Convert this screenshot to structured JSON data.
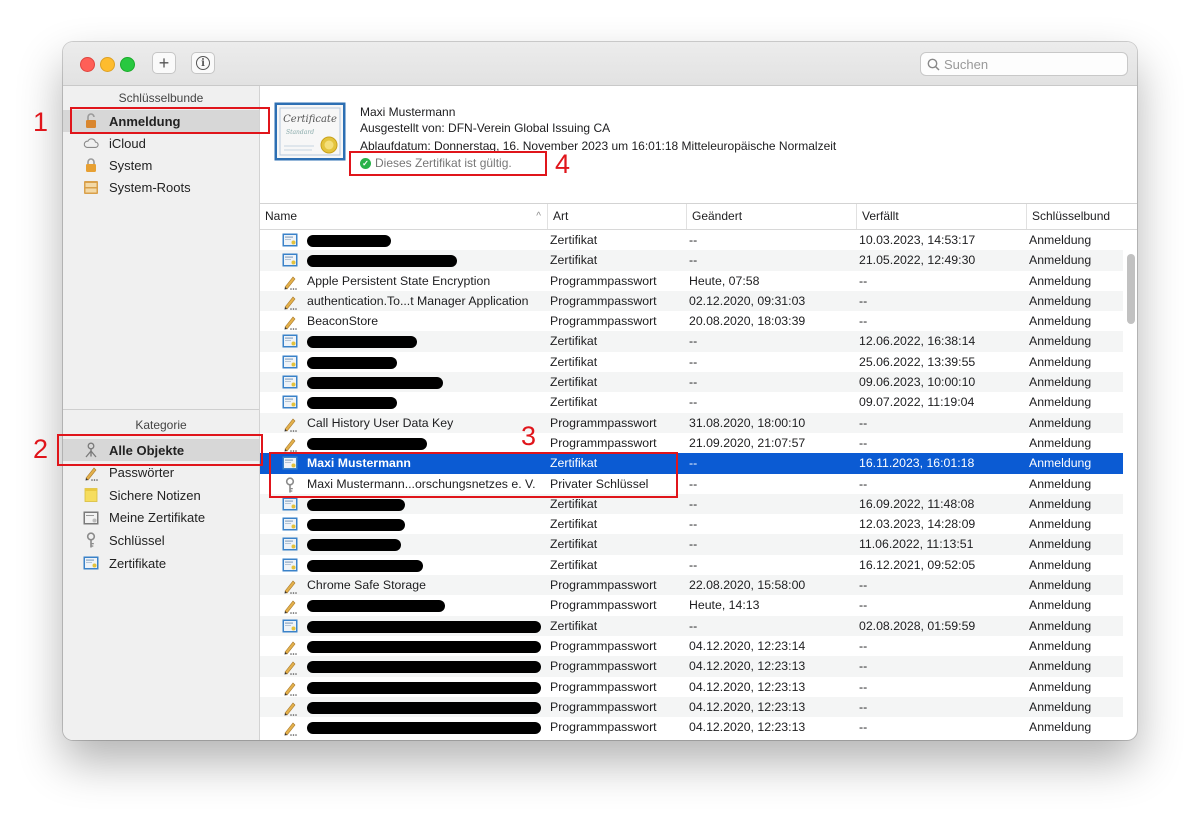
{
  "toolbar": {
    "add_label": "+",
    "info_label": "i",
    "search_placeholder": "Suchen"
  },
  "sidebar": {
    "keychains_heading": "Schlüsselbunde",
    "keychains": [
      {
        "label": "Anmeldung",
        "icon": "unlocked-lock-icon",
        "selected": true
      },
      {
        "label": "iCloud",
        "icon": "cloud-icon",
        "selected": false
      },
      {
        "label": "System",
        "icon": "lock-icon",
        "selected": false
      },
      {
        "label": "System-Roots",
        "icon": "cabinet-icon",
        "selected": false
      }
    ],
    "category_heading": "Kategorie",
    "categories": [
      {
        "label": "Alle Objekte",
        "icon": "all-items-icon",
        "selected": true
      },
      {
        "label": "Passwörter",
        "icon": "pencil-icon",
        "selected": false
      },
      {
        "label": "Sichere Notizen",
        "icon": "note-icon",
        "selected": false
      },
      {
        "label": "Meine Zertifikate",
        "icon": "my-certificate-icon",
        "selected": false
      },
      {
        "label": "Schlüssel",
        "icon": "key-icon",
        "selected": false
      },
      {
        "label": "Zertifikate",
        "icon": "certificate-icon",
        "selected": false
      }
    ]
  },
  "detail": {
    "name": "Maxi Mustermann",
    "issued_by": "Ausgestellt von: DFN-Verein Global Issuing CA",
    "expiry": "Ablaufdatum: Donnerstag, 16. November 2023 um 16:01:18 Mitteleuropäische Normalzeit",
    "status": "Dieses Zertifikat ist gültig."
  },
  "table": {
    "columns": [
      "Name",
      "Art",
      "Geändert",
      "Verfällt",
      "Schlüsselbund"
    ],
    "sort_indicator": "^",
    "rows": [
      {
        "icon": "certificate-icon",
        "name": "",
        "redacted": true,
        "art": "Zertifikat",
        "changed": "--",
        "expires": "10.03.2023, 14:53:17",
        "keychain": "Anmeldung"
      },
      {
        "icon": "certificate-icon",
        "name": "",
        "redacted": true,
        "art": "Zertifikat",
        "changed": "--",
        "expires": "21.05.2022, 12:49:30",
        "keychain": "Anmeldung"
      },
      {
        "icon": "pencil-icon",
        "name": "Apple Persistent State Encryption",
        "redacted": false,
        "art": "Programmpasswort",
        "changed": "Heute, 07:58",
        "expires": "--",
        "keychain": "Anmeldung"
      },
      {
        "icon": "pencil-icon",
        "name": "authentication.To...t Manager Application",
        "redacted": false,
        "art": "Programmpasswort",
        "changed": "02.12.2020, 09:31:03",
        "expires": "--",
        "keychain": "Anmeldung"
      },
      {
        "icon": "pencil-icon",
        "name": "BeaconStore",
        "redacted": false,
        "art": "Programmpasswort",
        "changed": "20.08.2020, 18:03:39",
        "expires": "--",
        "keychain": "Anmeldung"
      },
      {
        "icon": "certificate-icon",
        "name": "",
        "redacted": true,
        "art": "Zertifikat",
        "changed": "--",
        "expires": "12.06.2022, 16:38:14",
        "keychain": "Anmeldung"
      },
      {
        "icon": "certificate-icon",
        "name": "",
        "redacted": true,
        "art": "Zertifikat",
        "changed": "--",
        "expires": "25.06.2022, 13:39:55",
        "keychain": "Anmeldung"
      },
      {
        "icon": "certificate-icon",
        "name": "",
        "redacted": true,
        "art": "Zertifikat",
        "changed": "--",
        "expires": "09.06.2023, 10:00:10",
        "keychain": "Anmeldung"
      },
      {
        "icon": "certificate-icon",
        "name": "",
        "redacted": true,
        "art": "Zertifikat",
        "changed": "--",
        "expires": "09.07.2022, 11:19:04",
        "keychain": "Anmeldung"
      },
      {
        "icon": "pencil-icon",
        "name": "Call History User Data Key",
        "redacted": false,
        "art": "Programmpasswort",
        "changed": "31.08.2020, 18:00:10",
        "expires": "--",
        "keychain": "Anmeldung"
      },
      {
        "icon": "pencil-icon",
        "name": "",
        "redacted": true,
        "art": "Programmpasswort",
        "changed": "21.09.2020, 21:07:57",
        "expires": "--",
        "keychain": "Anmeldung"
      },
      {
        "icon": "certificate-icon",
        "name": "Maxi Mustermann",
        "redacted": false,
        "selected": true,
        "art": "Zertifikat",
        "changed": "--",
        "expires": "16.11.2023, 16:01:18",
        "keychain": "Anmeldung"
      },
      {
        "icon": "key-icon",
        "name": "Maxi Mustermann...orschungsnetzes e. V.",
        "redacted": false,
        "art": "Privater Schlüssel",
        "changed": "--",
        "expires": "--",
        "keychain": "Anmeldung"
      },
      {
        "icon": "certificate-icon",
        "name": "",
        "redacted": true,
        "art": "Zertifikat",
        "changed": "--",
        "expires": "16.09.2022, 11:48:08",
        "keychain": "Anmeldung"
      },
      {
        "icon": "certificate-icon",
        "name": "",
        "redacted": true,
        "art": "Zertifikat",
        "changed": "--",
        "expires": "12.03.2023, 14:28:09",
        "keychain": "Anmeldung"
      },
      {
        "icon": "certificate-icon",
        "name": "",
        "redacted": true,
        "art": "Zertifikat",
        "changed": "--",
        "expires": "11.06.2022, 11:13:51",
        "keychain": "Anmeldung"
      },
      {
        "icon": "certificate-icon",
        "name": "",
        "redacted": true,
        "art": "Zertifikat",
        "changed": "--",
        "expires": "16.12.2021, 09:52:05",
        "keychain": "Anmeldung"
      },
      {
        "icon": "pencil-icon",
        "name": "Chrome Safe Storage",
        "redacted": false,
        "art": "Programmpasswort",
        "changed": "22.08.2020, 15:58:00",
        "expires": "--",
        "keychain": "Anmeldung"
      },
      {
        "icon": "pencil-icon",
        "name": "",
        "redacted": true,
        "art": "Programmpasswort",
        "changed": "Heute, 14:13",
        "expires": "--",
        "keychain": "Anmeldung"
      },
      {
        "icon": "certificate-icon",
        "name": "",
        "redacted": true,
        "art": "Zertifikat",
        "changed": "--",
        "expires": "02.08.2028, 01:59:59",
        "keychain": "Anmeldung"
      },
      {
        "icon": "pencil-icon",
        "name": "",
        "redacted": true,
        "art": "Programmpasswort",
        "changed": "04.12.2020, 12:23:14",
        "expires": "--",
        "keychain": "Anmeldung"
      },
      {
        "icon": "pencil-icon",
        "name": "",
        "redacted": true,
        "art": "Programmpasswort",
        "changed": "04.12.2020, 12:23:13",
        "expires": "--",
        "keychain": "Anmeldung"
      },
      {
        "icon": "pencil-icon",
        "name": "",
        "redacted": true,
        "art": "Programmpasswort",
        "changed": "04.12.2020, 12:23:13",
        "expires": "--",
        "keychain": "Anmeldung"
      },
      {
        "icon": "pencil-icon",
        "name": "",
        "redacted": true,
        "art": "Programmpasswort",
        "changed": "04.12.2020, 12:23:13",
        "expires": "--",
        "keychain": "Anmeldung"
      },
      {
        "icon": "pencil-icon",
        "name": "",
        "redacted": true,
        "art": "Programmpasswort",
        "changed": "04.12.2020, 12:23:13",
        "expires": "--",
        "keychain": "Anmeldung"
      }
    ]
  },
  "annotations": [
    "1",
    "2",
    "3",
    "4"
  ],
  "colors": {
    "selection": "#0b5bd3",
    "callout": "#e0151b",
    "valid": "#28b249"
  }
}
